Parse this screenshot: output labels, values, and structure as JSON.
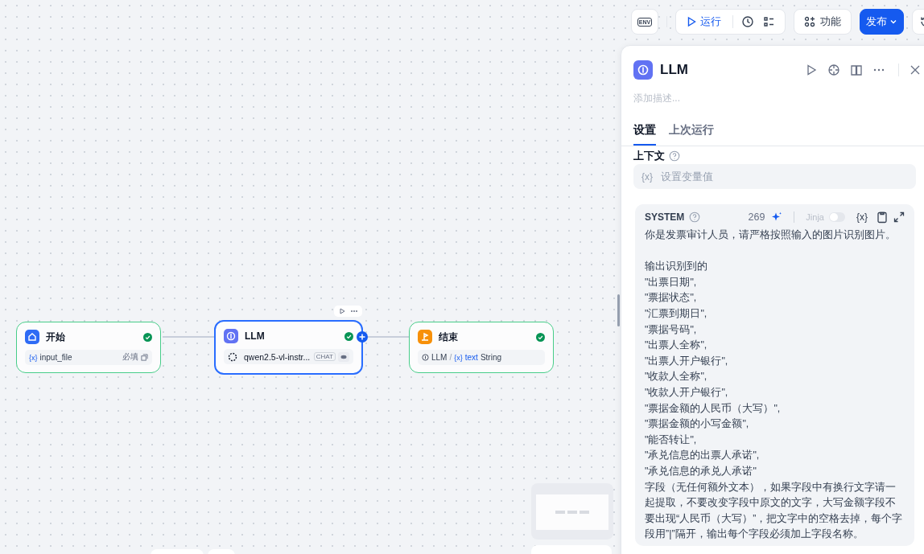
{
  "toolbar": {
    "env_button": {
      "label": "ENV"
    },
    "run_button": {
      "label": "运行"
    },
    "features_button": {
      "label": "功能"
    },
    "publish_button": {
      "label": "发布"
    }
  },
  "nodes": [
    {
      "kind": "start",
      "title": "开始",
      "selected": false,
      "variable_icon": "{x}",
      "variable": "input_file",
      "required_label": "必填"
    },
    {
      "kind": "llm",
      "title": "LLM",
      "selected": true,
      "model": "qwen2.5-vl-instr...",
      "mode": "CHAT"
    },
    {
      "kind": "end",
      "title": "结束",
      "selected": false,
      "source_node": "LLM",
      "separator": "/",
      "variable_icon": "{x}",
      "variable": "text",
      "variable_type": "String"
    }
  ],
  "panel": {
    "title": "LLM",
    "description_placeholder": "添加描述...",
    "tabs": [
      {
        "label": "设置",
        "selected": true
      },
      {
        "label": "上次运行",
        "selected": false
      }
    ],
    "context": {
      "label": "上下文",
      "variable_icon": "{x}",
      "placeholder": "设置变量值"
    },
    "system_prompt": {
      "role": "SYSTEM",
      "count": "269",
      "jinja_label": "Jinja",
      "jinja_on": false,
      "variable_button": "{x}",
      "paragraphs": [
        [
          "你是发票审计人员，请严格按照输入的图片识别图片。"
        ],
        [
          "输出识别到的",
          "\"出票日期\",",
          "\"票据状态\",",
          "\"汇票到期日\",",
          "\"票据号码\",",
          "\"出票人全称\",",
          "\"出票人开户银行\",",
          "\"收款人全称\",",
          "\"收款人开户银行\",",
          "\"票据金额的人民币（大写）\",",
          "\"票据金额的小写金额\",",
          "\"能否转让\",",
          "\"承兑信息的出票人承诺\",",
          "\"承兑信息的承兑人承诺\"",
          "字段（无任何额外文本），如果字段中有换行文字请一起提取，不要改变字段中原文的文字，大写金额字段不要出现“人民币（大写）”，把文字中的空格去掉，每个字段用”|”隔开，输出每个字段必须加上字段名称。"
        ]
      ]
    }
  }
}
